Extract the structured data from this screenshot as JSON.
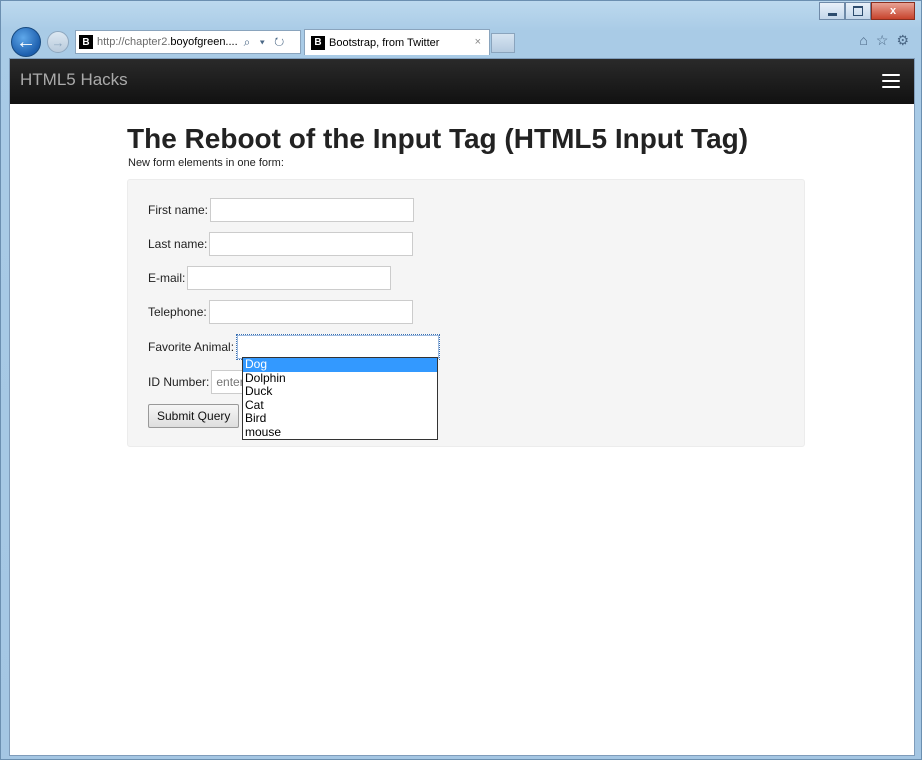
{
  "browser": {
    "address_prefix": "http://chapter2.",
    "address_host": "boyofgreen....",
    "address_icons": "⌕ ▾ ↻",
    "tab_title": "Bootstrap, from Twitter",
    "tab_close": "×",
    "favicon_letter": "B",
    "right_icons": [
      "⌂",
      "☆",
      "⚙"
    ]
  },
  "navbar": {
    "brand": "HTML5 Hacks"
  },
  "page": {
    "title": "The Reboot of the Input Tag (HTML5 Input Tag)",
    "subtitle": "New form elements in one form:"
  },
  "form": {
    "first_name_label": "First name:",
    "last_name_label": "Last name:",
    "email_label": "E-mail:",
    "telephone_label": "Telephone:",
    "animal_label": "Favorite Animal:",
    "id_label": "ID Number:",
    "id_placeholder": "enter your ID number",
    "submit_label": "Submit Query",
    "animal_options": [
      "Dog",
      "Dolphin",
      "Duck",
      "Cat",
      "Bird",
      "mouse"
    ],
    "animal_highlighted": "Dog"
  },
  "colors": {
    "navbar": "#1b1b1b",
    "highlight": "#3399ff",
    "well": "#f5f5f5"
  }
}
